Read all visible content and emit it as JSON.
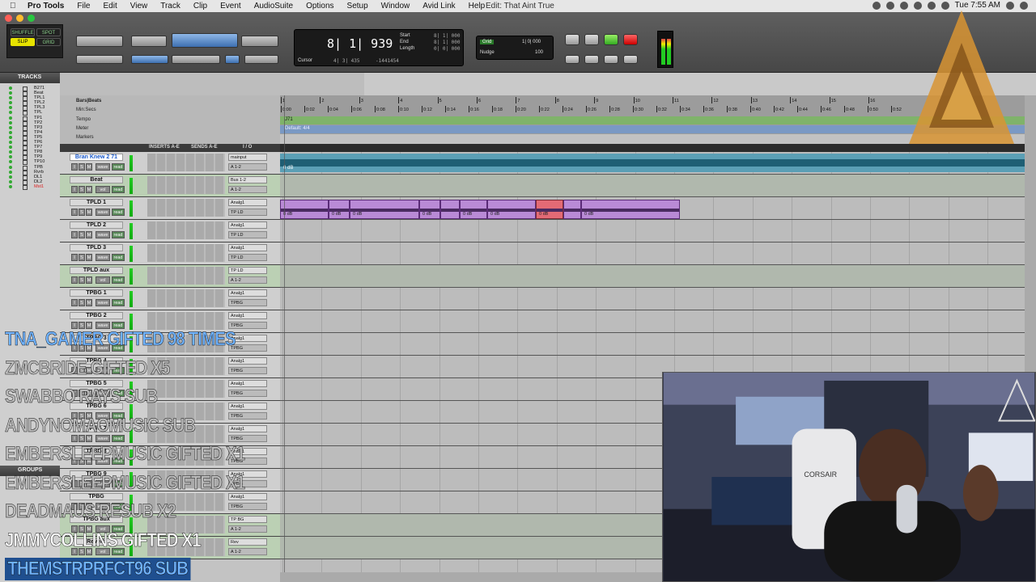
{
  "menubar": {
    "app": "Pro Tools",
    "menus": [
      "File",
      "Edit",
      "View",
      "Track",
      "Clip",
      "Event",
      "AudioSuite",
      "Options",
      "Setup",
      "Window",
      "Avid Link",
      "Help"
    ],
    "window_title": "Edit: That Aint True",
    "clock": "Tue 7:55 AM"
  },
  "toolbar": {
    "edit_modes": [
      "SHUFFLE",
      "SPOT",
      "SLIP",
      "GRID"
    ],
    "counter_main": "8| 1| 939",
    "start_label": "Start",
    "end_label": "End",
    "length_label": "Length",
    "start_val": "8| 1| 000",
    "end_val": "8| 1| 000",
    "length_val": "0| 0| 000",
    "cursor_label": "Cursor",
    "cursor_val": "4| 3| 435",
    "cursor_sample": "-1441454",
    "grid_label": "Grid",
    "grid_val": "1| 0| 000",
    "nudge_label": "Nudge",
    "nudge_val": "100"
  },
  "tracks_panel": {
    "header": "TRACKS",
    "items": [
      "B271",
      "Beat",
      "TPL1",
      "TPL2",
      "TPL3",
      "TPL",
      "TP1",
      "TP2",
      "TP3",
      "TP4",
      "TP5",
      "TP6",
      "TP7",
      "TP8",
      "TP9",
      "TP10",
      "TPB",
      "Rvrb",
      "DL1",
      "DL2",
      "Mst1"
    ],
    "groups_header": "GROUPS"
  },
  "rulers": {
    "labels": [
      "Bars|Beats",
      "Min:Secs",
      "Tempo",
      "Meter",
      "Markers"
    ],
    "bars": [
      "1",
      "2",
      "3",
      "4",
      "5",
      "6",
      "7",
      "8",
      "9",
      "10",
      "11",
      "12",
      "13",
      "14",
      "15",
      "16"
    ],
    "mins": [
      "0:00",
      "0:02",
      "0:04",
      "0:06",
      "0:08",
      "0:10",
      "0:12",
      "0:14",
      "0:16",
      "0:18",
      "0:20",
      "0:22",
      "0:24",
      "0:26",
      "0:28",
      "0:30",
      "0:32",
      "0:34",
      "0:36",
      "0:38",
      "0:40",
      "0:42",
      "0:44",
      "0:46",
      "0:48",
      "0:50",
      "0:52"
    ],
    "tempo_val": "J71",
    "meter_val": "Default: 4/4"
  },
  "mix_header": {
    "inserts": "INSERTS A-E",
    "sends": "SENDS A-E",
    "io": "I / O"
  },
  "tracks": [
    {
      "name": "Bran Knew 2 71",
      "io1": "mainput",
      "io2": "A 1-2",
      "type": "aud",
      "active": true
    },
    {
      "name": "Beat",
      "io1": "Bus 1-2",
      "io2": "A 1-2",
      "type": "aux"
    },
    {
      "name": "TPLD 1",
      "io1": "Analg1",
      "io2": "TP LD",
      "type": "aud"
    },
    {
      "name": "TPLD 2",
      "io1": "Analg1",
      "io2": "TP LD",
      "type": "aud"
    },
    {
      "name": "TPLD 3",
      "io1": "Analg1",
      "io2": "TP LD",
      "type": "aud"
    },
    {
      "name": "TPLD aux",
      "io1": "TP LD",
      "io2": "A 1-2",
      "type": "aux"
    },
    {
      "name": "TPBG 1",
      "io1": "Analg1",
      "io2": "TPBG",
      "type": "aud"
    },
    {
      "name": "TPBG 2",
      "io1": "Analg1",
      "io2": "TPBG",
      "type": "aud"
    },
    {
      "name": "TPBG 3",
      "io1": "Analg1",
      "io2": "TPBG",
      "type": "aud"
    },
    {
      "name": "TPBG 4",
      "io1": "Analg1",
      "io2": "TPBG",
      "type": "aud"
    },
    {
      "name": "TPBG 5",
      "io1": "Analg1",
      "io2": "TPBG",
      "type": "aud"
    },
    {
      "name": "TPBG 6",
      "io1": "Analg1",
      "io2": "TPBG",
      "type": "aud"
    },
    {
      "name": "TPBG 7",
      "io1": "Analg1",
      "io2": "TPBG",
      "type": "aud"
    },
    {
      "name": "TPBG 8",
      "io1": "Analg1",
      "io2": "TPBG",
      "type": "aud"
    },
    {
      "name": "TPBG 9",
      "io1": "Analg1",
      "io2": "TPBG",
      "type": "aud"
    },
    {
      "name": "TPBG",
      "io1": "Analg1",
      "io2": "TPBG",
      "type": "aud"
    },
    {
      "name": "TPBG aux",
      "io1": "TP BG",
      "io2": "A 1-2",
      "type": "aux"
    },
    {
      "name": "Reverb",
      "io1": "Rev",
      "io2": "A 1-2",
      "type": "aux"
    }
  ],
  "track_buttons": {
    "i": "I",
    "s": "S",
    "m": "M",
    "view": "wave",
    "auto": "read",
    "vol_view": "vol"
  },
  "clips": {
    "gain": "0 dB"
  },
  "chat": [
    {
      "text": "TNA_GAMER GIFTED 98 TIMES",
      "color": "#6fb3ff"
    },
    {
      "text": "ZMCBRIDE GIFTED X5",
      "color": "#bbbbbb"
    },
    {
      "text": "SWABBO RAYS SUB",
      "color": "#bbbbbb"
    },
    {
      "text": "ANDYNOMAOMUSIC SUB",
      "color": "#bbbbbb"
    },
    {
      "text": "EMBERSLEEPMUSIC GIFTED X1",
      "color": "#bbbbbb"
    },
    {
      "text": "EMBERSLEEPMUSIC GIFTED X1",
      "color": "#bbbbbb"
    },
    {
      "text": "DEADMAUS RESUB X2",
      "color": "#bbbbbb"
    },
    {
      "text": "JMMYCOLLINS GIFTED X1",
      "color": "#ffffff"
    },
    {
      "text": "THEMSTRPRFCT96 SUB",
      "color": "#6fb3ff"
    }
  ],
  "webcam": {
    "brand": "CORSAIR"
  },
  "colors": {
    "clip": "#b98ad6",
    "clip_selected": "#e36a75",
    "audio_wave": "#5b9fb5",
    "tempo": "#7fb36a",
    "meter": "#7a99c4"
  }
}
